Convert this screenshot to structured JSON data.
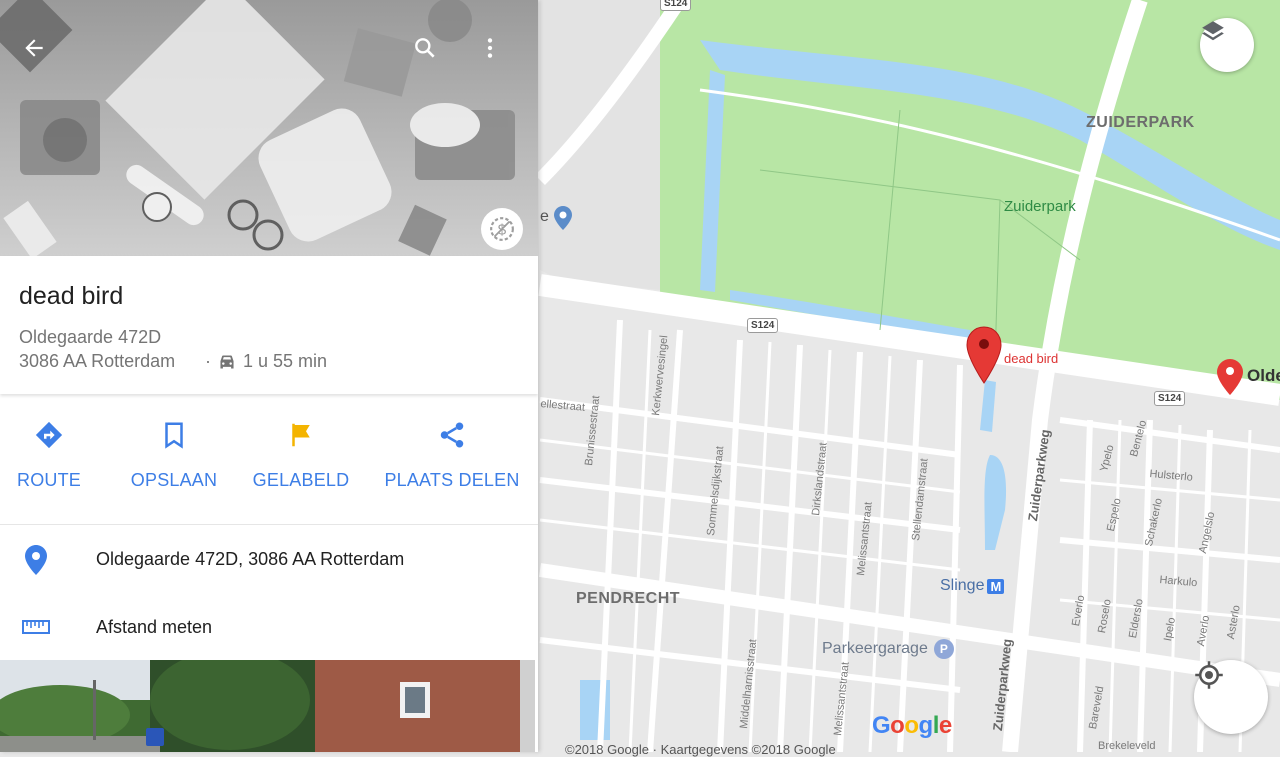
{
  "panel": {
    "place_title": "dead bird",
    "address_line1": "Oldegaarde 472D",
    "address_line2": "3086 AA Rotterdam",
    "separator": "·",
    "drive_time": "1 u 55 min",
    "actions": [
      {
        "label": "ROUTE",
        "icon": "directions-icon"
      },
      {
        "label": "OPSLAAN",
        "icon": "bookmark-icon"
      },
      {
        "label": "GELABELD",
        "icon": "flag-icon"
      },
      {
        "label": "PLAATS DELEN",
        "icon": "share-icon"
      }
    ],
    "full_address": "Oldegaarde 472D, 3086 AA Rotterdam",
    "measure_label": "Afstand meten",
    "hero_icons": [
      "back-arrow-icon",
      "search-icon",
      "more-vert-icon",
      "price-tag-icon"
    ]
  },
  "map": {
    "districts": [
      "ZUIDERPARK",
      "PENDRECHT"
    ],
    "park_name": "Zuiderpark",
    "road_badges": [
      "S124",
      "S124",
      "S124"
    ],
    "pin_labels": [
      "dead bird",
      "Olde"
    ],
    "metro_station": "Slinge",
    "metro_badge": "M",
    "parking": "Parkeergarage",
    "parking_badge": "P",
    "partial_label": "e",
    "streets": [
      "Zuiderparkweg",
      "Kerkwervesingel",
      "Sommelsdijkstraat",
      "Dirkslandstraat",
      "Stellendamstraat",
      "Melissantstraat",
      "Middelharnisstraat",
      "Brunissestraat",
      "ellestraat",
      "Bentelo",
      "Hulsterlo",
      "Espelo",
      "Schakerlo",
      "Angelslo",
      "Harkulo",
      "Everlo",
      "Roselo",
      "Elderslo",
      "Ipelo",
      "Averlo",
      "Asterlo",
      "Bareveld",
      "Brekeleveld",
      "Ypelo",
      "Melissantstraat",
      "Zuiderparkweg"
    ],
    "google_logo": "Google",
    "copyright": "©2018 Google · Kaartgegevens ©2018 Google",
    "colors": {
      "park": "#b8e6a5",
      "water": "#a8d4f5",
      "road": "#ffffff",
      "land": "#e8e8e8",
      "pin": "#e53935",
      "accent": "#3d7ee6",
      "flag": "#f4b400"
    }
  }
}
